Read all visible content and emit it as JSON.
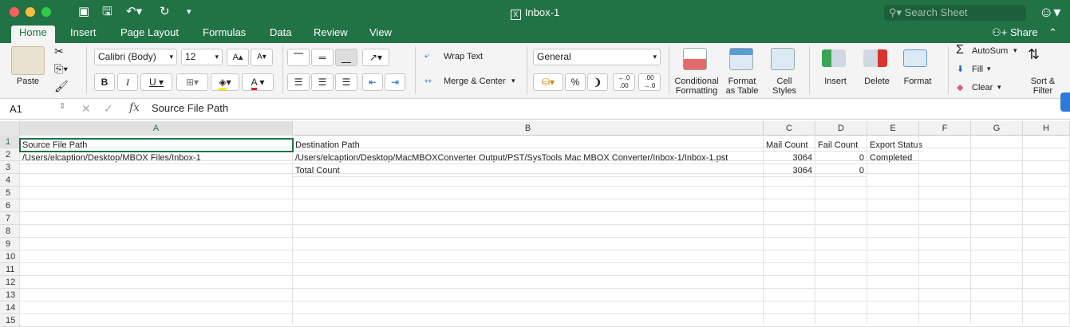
{
  "window": {
    "title": "Inbox-1",
    "search_placeholder": "Search Sheet"
  },
  "tabs": [
    "Home",
    "Insert",
    "Page Layout",
    "Formulas",
    "Data",
    "Review",
    "View"
  ],
  "share_label": "Share",
  "ribbon": {
    "paste": "Paste",
    "font_name": "Calibri (Body)",
    "font_size": "12",
    "wrap_text": "Wrap Text",
    "merge_center": "Merge & Center",
    "number_format": "General",
    "conditional_1": "Conditional",
    "conditional_2": "Formatting",
    "format_table_1": "Format",
    "format_table_2": "as Table",
    "cell_styles_1": "Cell",
    "cell_styles_2": "Styles",
    "insert": "Insert",
    "delete": "Delete",
    "format": "Format",
    "autosum": "AutoSum",
    "fill": "Fill",
    "clear": "Clear",
    "sort_1": "Sort &",
    "sort_2": "Filter"
  },
  "formula_bar": {
    "name_box": "A1",
    "fx": "fx",
    "formula": "Source File Path"
  },
  "columns": [
    "A",
    "B",
    "C",
    "D",
    "E",
    "F",
    "G",
    "H"
  ],
  "rows": [
    "1",
    "2",
    "3",
    "4",
    "5",
    "6",
    "7",
    "8",
    "9",
    "10",
    "11",
    "12",
    "13",
    "14",
    "15"
  ],
  "cells": {
    "a1": "Source File Path",
    "b1": "Destination Path",
    "c1": "Mail Count",
    "d1": "Fail Count",
    "e1": "Export Status",
    "a2": "/Users/elcaption/Desktop/MBOX Files/Inbox-1",
    "b2": "/Users/elcaption/Desktop/MacMBOXConverter Output/PST/SysTools Mac MBOX Converter/Inbox-1/Inbox-1.pst",
    "c2": "3064",
    "d2": "0",
    "e2": "Completed",
    "b3": "Total Count",
    "c3": "3064",
    "d3": "0"
  },
  "colors": {
    "accent": "#217346"
  }
}
